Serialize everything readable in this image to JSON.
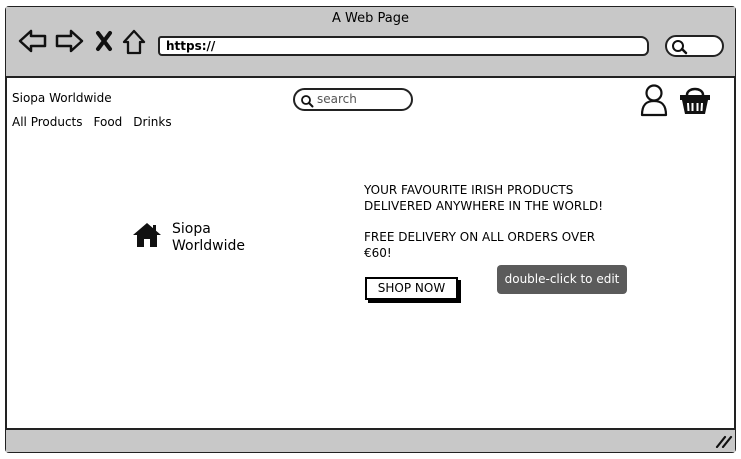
{
  "window": {
    "title": "A Web Page"
  },
  "browser": {
    "url": "https://"
  },
  "header": {
    "brand": "Siopa Worldwide",
    "search_placeholder": "search",
    "nav": [
      "All Products",
      "Food",
      "Drinks"
    ],
    "icons": [
      "user-icon",
      "basket-icon"
    ]
  },
  "hero": {
    "logo_text_line1": "Siopa",
    "logo_text_line2": "Worldwide",
    "headline_line1": "YOUR FAVOURITE IRISH PRODUCTS",
    "headline_line2": "DELIVERED ANYWHERE IN THE WORLD!",
    "promo_line1": "FREE DELIVERY ON ALL ORDERS OVER",
    "promo_line2": "€60!",
    "cta": "SHOP NOW"
  },
  "tooltip": "double-click to edit"
}
